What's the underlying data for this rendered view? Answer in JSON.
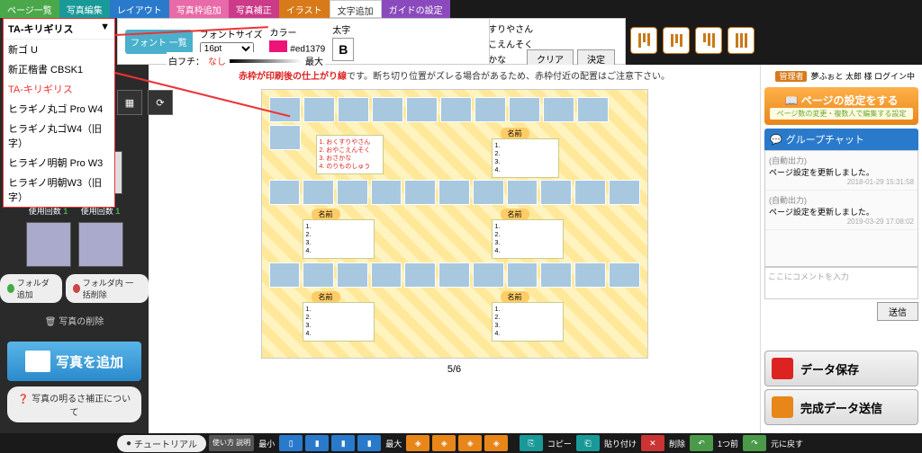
{
  "tabs": [
    "ページ一覧",
    "写真編集",
    "レイアウト",
    "写真枠追加",
    "写真補正",
    "イラスト",
    "文字追加",
    "ガイドの設定"
  ],
  "toolbar": {
    "font_list_btn": "フォント\n一覧",
    "font_size_label": "フォントサイズ",
    "font_size_value": "16pt",
    "color_label": "カラー",
    "color_value": "#ed1379",
    "bold_label": "太字",
    "bold_btn": "B",
    "fuchi_label": "白フチ：",
    "fuchi_none": "なし",
    "fuchi_max": "最大"
  },
  "text_items": [
    "1. おくすりやさん",
    "2. おやこえんそく",
    "3. おさかな"
  ],
  "list_buttons": {
    "clear": "クリア",
    "decide": "決定"
  },
  "font_options": {
    "selected": "TA-キリギリス",
    "list": [
      "新ゴ U",
      "新正楷書 CBSK1",
      "TA-キリギリス",
      "ヒラギノ丸ゴ Pro W4",
      "ヒラギノ丸ゴW4（旧字）",
      "ヒラギノ明朝 Pro W3",
      "ヒラギノ明朝W3（旧字）"
    ]
  },
  "sidebar": {
    "thumbs": [
      {
        "name": "F1.png",
        "count_label": "使用回数",
        "count": "1"
      },
      {
        "name": "F2.png",
        "count_label": "使用回数",
        "count": "1"
      }
    ],
    "folder_add": "フォルダ追加",
    "folder_del": "フォルダ内\n一括削除",
    "photo_del": "写真の削除",
    "add_photo": "写真を追加",
    "brightness": "写真の明るさ補正について"
  },
  "canvas": {
    "warning_red": "赤枠が印刷後の仕上がり線",
    "warning_rest": "です。断ち切り位置がズレる場合があるため、赤枠付近の配置はご注意下さい。",
    "sample_lines": [
      "1. おくすりやさん",
      "2. おやこえんそく",
      "3. おさかな",
      "4. のりものしゅう"
    ],
    "numbered": [
      "1.",
      "2.",
      "3.",
      "4."
    ],
    "name_tag": "名前",
    "pager": "5/6"
  },
  "right": {
    "badge": "管理者",
    "login_text": "夢ふぉと 太郎 様 ログイン中",
    "settings_title": "ページの設定をする",
    "settings_sub": "ページ数の変更・複数人で編集する設定",
    "chat_title": "グループチャット",
    "messages": [
      {
        "auto": "(自動出力)",
        "text": "ページ設定を更新しました。",
        "ts": "2018-01-29 15:31:58"
      },
      {
        "auto": "(自動出力)",
        "text": "ページ設定を更新しました。",
        "ts": "2019-03-29 17:08:02"
      }
    ],
    "chat_placeholder": "ここにコメントを入力",
    "send": "送信",
    "save_btn": "データ保存",
    "submit_btn": "完成データ送信"
  },
  "bottom": {
    "tutorial": "チュートリアル",
    "howto": "使い方\n説明",
    "labels": {
      "min": "最小",
      "max": "最大",
      "copy": "コピー",
      "paste": "貼り付け",
      "delete": "削除",
      "undo": "1つ前",
      "redo": "元に戻す"
    }
  }
}
